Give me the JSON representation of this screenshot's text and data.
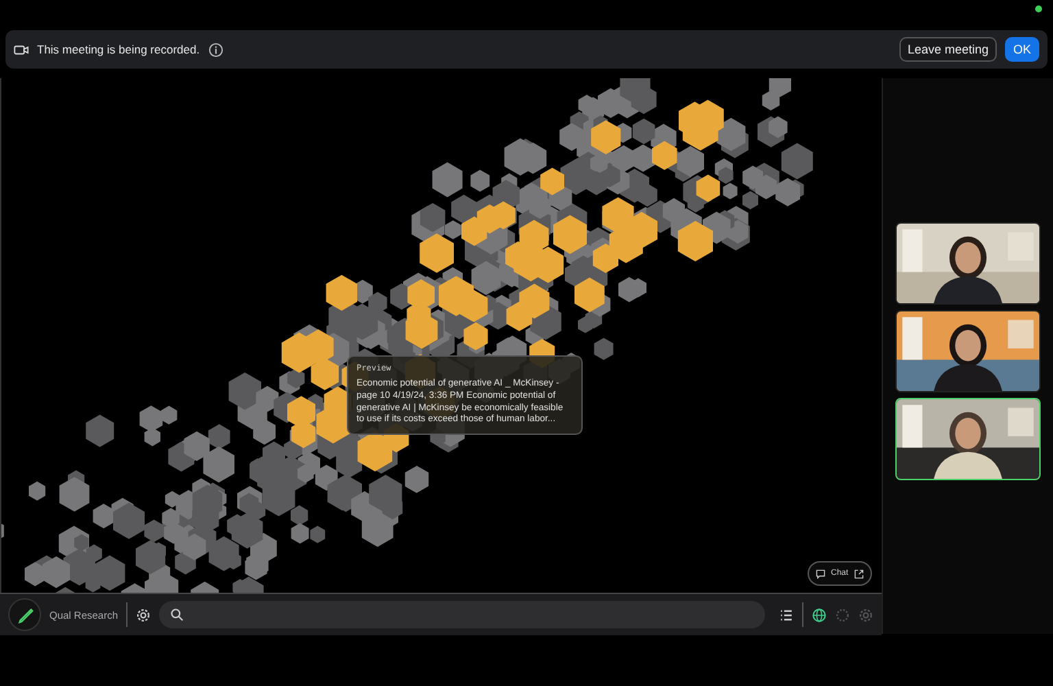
{
  "banner": {
    "message": "This meeting is being recorded.",
    "leave_button": "Leave meeting",
    "ok_button": "OK"
  },
  "shared_screen": {
    "tooltip": {
      "title": "Preview",
      "text": "Economic potential of generative AI _ McKinsey - page 10 4/19/24, 3:36 PM Economic potential of generative AI | McKinsey be economically feasible to use if its costs exceed those of human labor..."
    },
    "chat_button": "Chat"
  },
  "toolbar": {
    "app_name": "Qual Research"
  },
  "participants": [
    {
      "kind": "picture",
      "selected": false
    },
    {
      "kind": "picture",
      "selected": false
    },
    {
      "kind": "picture",
      "selected": true
    }
  ]
}
